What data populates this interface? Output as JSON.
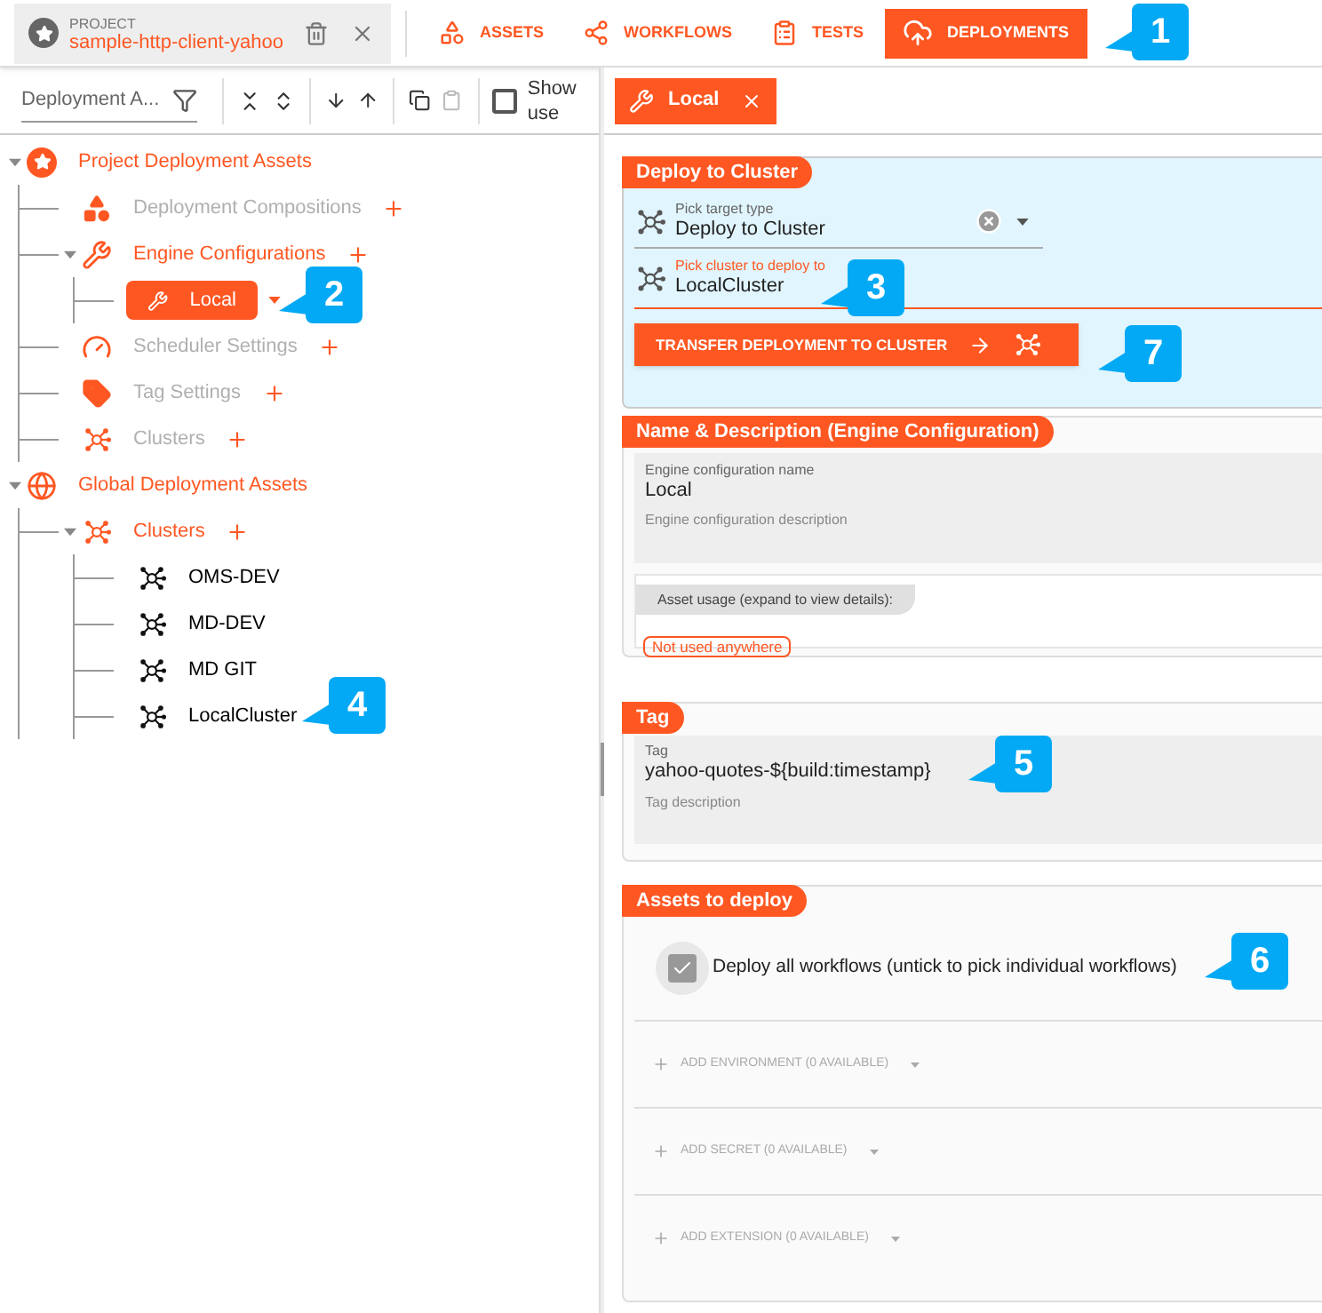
{
  "project": {
    "label": "PROJECT",
    "name": "sample-http-client-yahoo"
  },
  "nav_tabs": [
    {
      "label": "ASSETS",
      "kind": "assets",
      "selected": false
    },
    {
      "label": "WORKFLOWS",
      "kind": "workflows",
      "selected": false
    },
    {
      "label": "TESTS",
      "kind": "tests",
      "selected": false
    },
    {
      "label": "DEPLOYMENTS",
      "kind": "deployments",
      "selected": true
    }
  ],
  "toolbar": {
    "filter_value": "Deployment A...",
    "show_use": {
      "label": "Show use",
      "checked": false
    }
  },
  "tree": [
    {
      "label": "Project Deployment Assets",
      "kind": "star",
      "selected": false,
      "expanded": true,
      "children": [
        {
          "label": "Deployment Compositions",
          "kind": "shapes",
          "muted": true,
          "selected": false,
          "add": true
        },
        {
          "label": "Engine Configurations",
          "kind": "engine",
          "muted": false,
          "selected": false,
          "add": true,
          "expanded": true,
          "children": [
            {
              "label": "Local",
              "kind": "engine",
              "selected": true
            }
          ]
        },
        {
          "label": "Scheduler Settings",
          "kind": "gauge",
          "muted": true,
          "selected": false,
          "add": true
        },
        {
          "label": "Tag Settings",
          "kind": "tag",
          "muted": true,
          "selected": false,
          "add": true
        },
        {
          "label": "Clusters",
          "kind": "cluster",
          "muted": true,
          "selected": false,
          "add": true
        }
      ]
    },
    {
      "label": "Global Deployment Assets",
      "kind": "globe",
      "selected": false,
      "expanded": true,
      "children": [
        {
          "label": "Clusters",
          "kind": "cluster",
          "selected": false,
          "add": true,
          "expanded": true,
          "children": [
            {
              "label": "OMS-DEV",
              "kind": "cluster",
              "selected": false
            },
            {
              "label": "MD-DEV",
              "kind": "cluster",
              "selected": false
            },
            {
              "label": "MD GIT",
              "kind": "cluster",
              "selected": false
            },
            {
              "label": "LocalCluster",
              "kind": "cluster",
              "selected": false
            }
          ]
        }
      ]
    }
  ],
  "editor_tabs": [
    {
      "label": "Local",
      "selected": true
    }
  ],
  "deploy": {
    "title": "Deploy to Cluster",
    "target": {
      "label": "Pick target type",
      "value": "Deploy to Cluster"
    },
    "cluster": {
      "label": "Pick cluster to deploy to",
      "value": "LocalCluster"
    },
    "button": "TRANSFER DEPLOYMENT TO CLUSTER"
  },
  "name_section": {
    "title": "Name & Description (Engine Configuration)",
    "name": {
      "label": "Engine configuration name",
      "value": "Local"
    },
    "description": {
      "placeholder": "Engine configuration description"
    },
    "usage_label": "Asset usage (expand to view details):",
    "usage_badge": "Not used anywhere"
  },
  "tag_section": {
    "title": "Tag",
    "tag": {
      "label": "Tag",
      "value": "yahoo-quotes-${build:timestamp}"
    },
    "description": {
      "placeholder": "Tag description"
    }
  },
  "assets_section": {
    "title": "Assets to deploy",
    "deploy_all": {
      "label": "Deploy all workflows (untick to pick individual workflows)",
      "checked": true
    },
    "add_rows": [
      {
        "label": "ADD ENVIRONMENT (0 AVAILABLE)",
        "disabled": true
      },
      {
        "label": "ADD SECRET (0 AVAILABLE)",
        "disabled": true
      },
      {
        "label": "ADD EXTENSION (0 AVAILABLE)",
        "disabled": true
      }
    ]
  },
  "callouts": [
    "1",
    "2",
    "3",
    "4",
    "5",
    "6",
    "7"
  ]
}
